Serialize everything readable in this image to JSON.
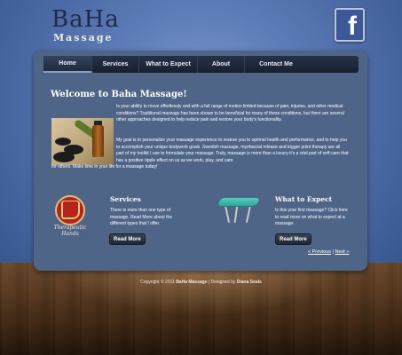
{
  "logo": {
    "title": "BaHa",
    "subtitle": "Massage"
  },
  "social": {
    "facebook_glyph": "f"
  },
  "nav": {
    "items": [
      {
        "label": "Home"
      },
      {
        "label": "Services"
      },
      {
        "label": "What to Expect"
      },
      {
        "label": "About"
      },
      {
        "label": "Contact Me"
      }
    ]
  },
  "main": {
    "heading": "Welcome to Baha Massage!",
    "paragraph1": "Is your ability to move effortlessly and with a full range of motion limited because of pain, injuries, and other medical conditions? Traditional massage has been shown to be beneficial for many of these conditions, but there are several other approaches designed to help reduce pain and restore your body's functionality.",
    "paragraph2": "My goal is to personalize your massage experience to restore you to optimal health and performance, and to help you to accomplish your unique bodywork goals. Swedish massage, myofascial release and trigger point therapy are all part of my toolkit I use to formulate your massage. Truly, massage is more than a luxury-it's a vital part of self-care that has a positive ripple effect on us as we work, play, and care",
    "paragraph3": "for others. Make time in your life for a massage today!"
  },
  "badge": {
    "line1": "Therapeutic",
    "line2": "Hands"
  },
  "services": {
    "title": "Services",
    "text": "There is more than one type of massage. Read More about the different types that I offer.",
    "button": "Read More"
  },
  "expect": {
    "title": "What to Expect",
    "text": "Is this your first massage? Click here to read more on what to expect at a massage.",
    "button": "Read More"
  },
  "pager": {
    "previous": "« Previous",
    "separator": "|",
    "next": "Next »"
  },
  "footer": {
    "prefix": "Copyright © 2011",
    "brand": "BaHa Massage",
    "middle": "| Designed by",
    "designer": "Diana Seals"
  },
  "colors": {
    "panel": "#4f6587",
    "nav": "#1d2634",
    "background": "#4a6aa6"
  }
}
